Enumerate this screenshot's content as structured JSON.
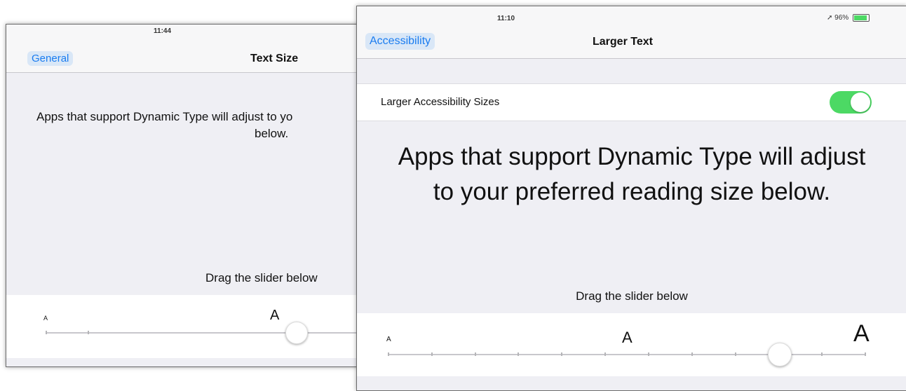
{
  "back_screen": {
    "status_time": "11:44",
    "back_label": "General",
    "title": "Text Size",
    "description": "Apps that support Dynamic Type will adjust to yo",
    "description_line2": "below.",
    "drag_hint": "Drag the slider below",
    "small_a": "A",
    "mid_a": "A"
  },
  "front_screen": {
    "status_time": "11:10",
    "status_right": "96%",
    "back_label": "Accessibility",
    "title": "Larger Text",
    "toggle_label": "Larger Accessibility Sizes",
    "toggle_on": true,
    "description_line1": "Apps that support Dynamic Type will adjust",
    "description_line2": "to your preferred reading size below.",
    "drag_hint": "Drag the slider below",
    "small_a": "A",
    "mid_a": "A",
    "big_a": "A",
    "slider_level_fraction": 0.82
  },
  "colors": {
    "accent": "#1a7cf0",
    "toggle_on": "#4cd964",
    "background": "#efeff4"
  }
}
